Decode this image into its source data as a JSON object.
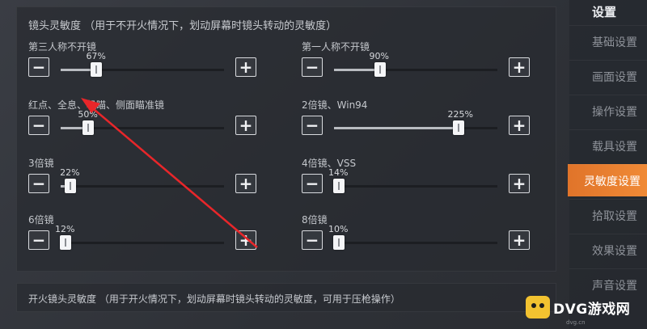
{
  "header": {
    "title": "镜头灵敏度 （用于不开火情况下，划动屏幕时镜头转动的灵敏度）"
  },
  "sliders": [
    {
      "label": "第三人称不开镜",
      "value_label": "67%",
      "value": 67,
      "fill": 0.22
    },
    {
      "label": "第一人称不开镜",
      "value_label": "90%",
      "value": 90,
      "fill": 0.28
    },
    {
      "label": "红点、全息、机瞄、侧面瞄准镜",
      "value_label": "50%",
      "value": 50,
      "fill": 0.17
    },
    {
      "label": "2倍镜、Win94",
      "value_label": "225%",
      "value": 225,
      "fill": 0.76
    },
    {
      "label": "3倍镜",
      "value_label": "22%",
      "value": 22,
      "fill": 0.06
    },
    {
      "label": "4倍镜、VSS",
      "value_label": "14%",
      "value": 14,
      "fill": 0.03
    },
    {
      "label": "6倍镜",
      "value_label": "12%",
      "value": 12,
      "fill": 0.03
    },
    {
      "label": "8倍镜",
      "value_label": "10%",
      "value": 10,
      "fill": 0.03
    }
  ],
  "footer": {
    "text": "开火镜头灵敏度 （用于开火情况下，划动屏幕时镜头转动的灵敏度，可用于压枪操作）"
  },
  "sidebar": {
    "title": "设置",
    "items": [
      {
        "label": "基础设置",
        "active": false
      },
      {
        "label": "画面设置",
        "active": false
      },
      {
        "label": "操作设置",
        "active": false
      },
      {
        "label": "载具设置",
        "active": false
      },
      {
        "label": "灵敏度设置",
        "active": true
      },
      {
        "label": "拾取设置",
        "active": false
      },
      {
        "label": "效果设置",
        "active": false
      },
      {
        "label": "声音设置",
        "active": false
      }
    ]
  },
  "watermark": {
    "text": "DVG游戏网",
    "sub": "dvg.cn"
  },
  "icons": {
    "minus": "minus-icon",
    "plus": "plus-icon",
    "arrow": "annotation-arrow"
  },
  "colors": {
    "accent": "#f08a36",
    "annotation": "#e8262a"
  }
}
